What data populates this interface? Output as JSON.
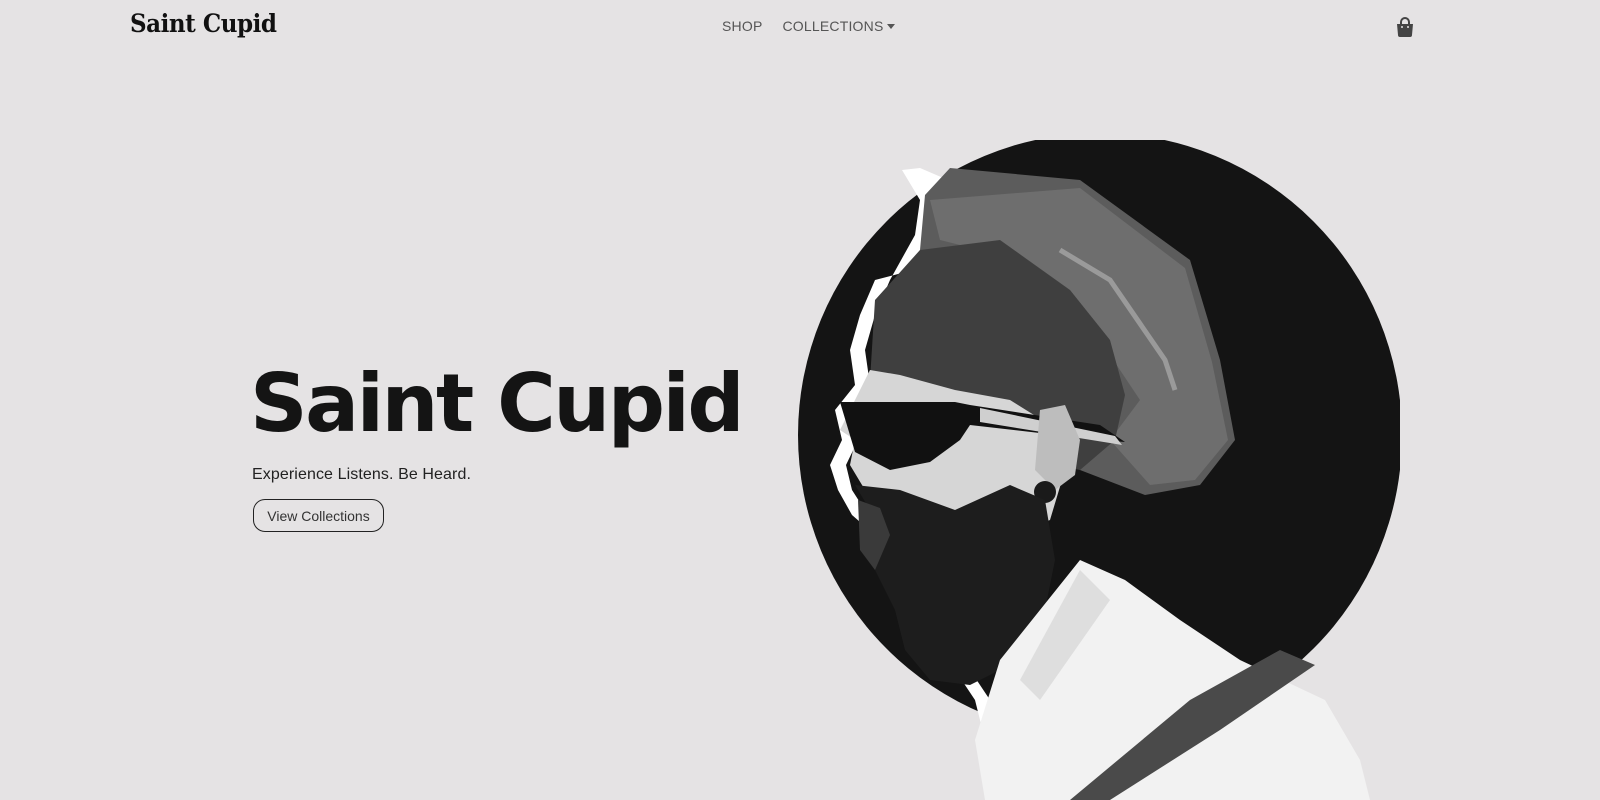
{
  "brand": {
    "name": "Saint Cupid"
  },
  "nav": {
    "items": [
      {
        "label": "SHOP",
        "has_dropdown": false
      },
      {
        "label": "COLLECTIONS",
        "has_dropdown": true
      }
    ],
    "cart_icon": "shopping-bag-icon"
  },
  "hero": {
    "title": "Saint Cupid",
    "subtitle": "Experience Listens. Be Heard.",
    "cta_label": "View Collections",
    "image": "bearded-man-in-hat-profile-photo"
  },
  "colors": {
    "background": "#e5e3e4",
    "text": "#141414",
    "circle": "#141414"
  }
}
